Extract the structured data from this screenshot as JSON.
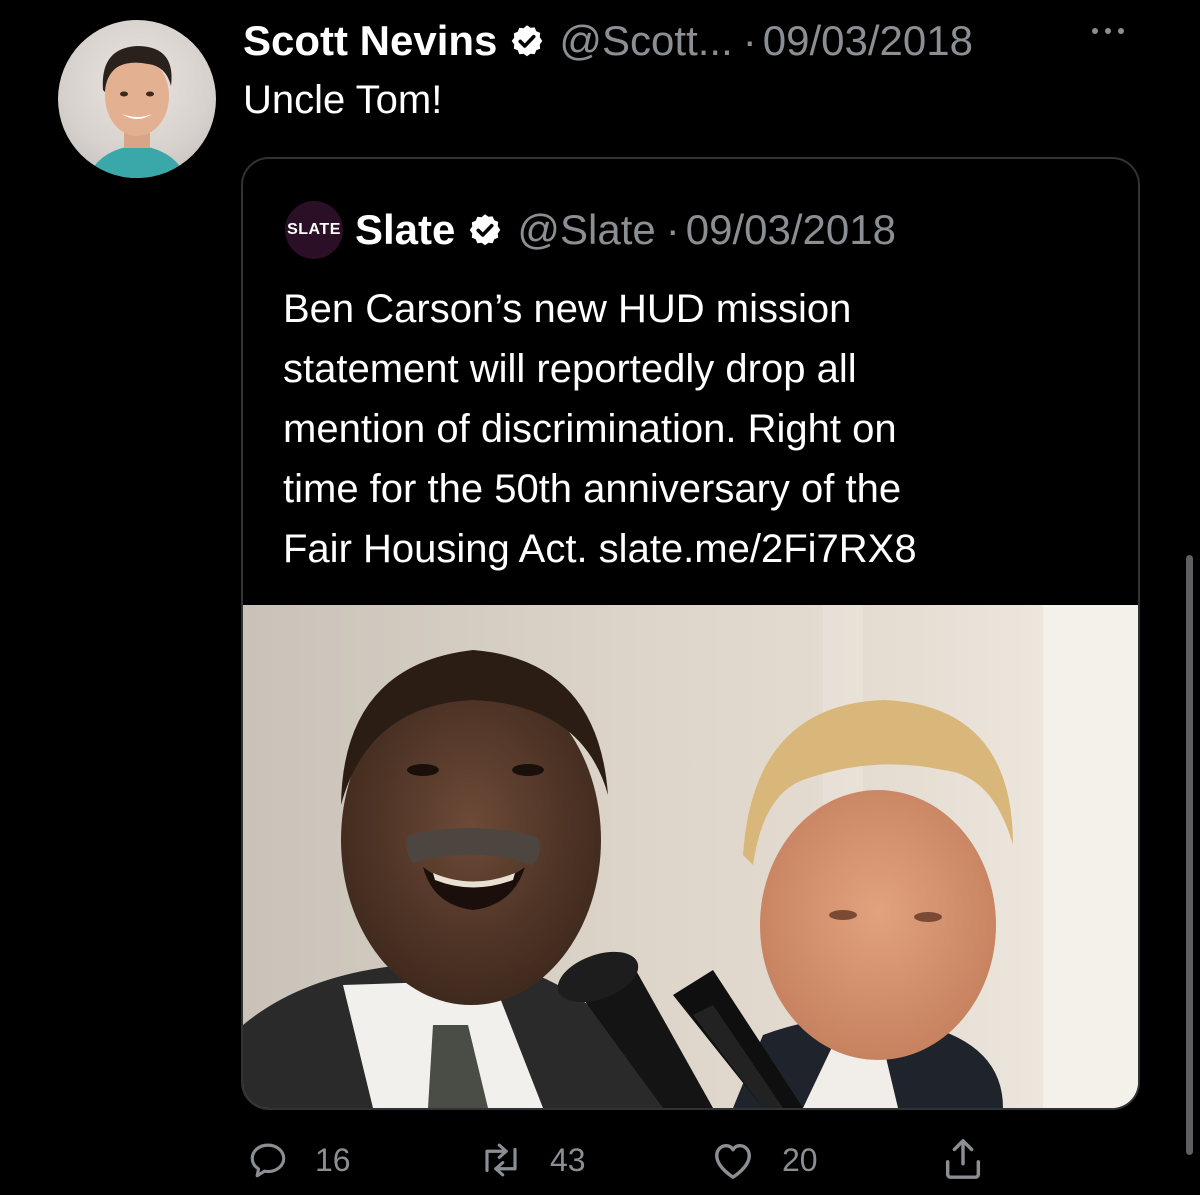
{
  "tweet": {
    "author_name": "Scott Nevins",
    "author_handle": "@Scott...",
    "separator": "·",
    "date": "09/03/2018",
    "text": "Uncle Tom!"
  },
  "quoted_tweet": {
    "logo_text": "SLATE",
    "author_name": "Slate",
    "author_handle": "@Slate",
    "separator": "·",
    "date": "09/03/2018",
    "text_lines": [
      "Ben Carson’s new HUD mission",
      "statement will reportedly drop all",
      "mention of discrimination. Right on",
      "time for the 50th anniversary of the",
      "Fair Housing Act. slate.me/2Fi7RX8"
    ]
  },
  "actions": {
    "replies": "16",
    "retweets": "43",
    "likes": "20"
  },
  "icons": {
    "verified": "verified-badge-icon",
    "more": "more-dots-icon",
    "reply": "reply-icon",
    "retweet": "retweet-icon",
    "like": "heart-icon",
    "share": "share-icon"
  },
  "colors": {
    "background": "#000000",
    "text": "#ffffff",
    "secondary_text": "#8b8e92",
    "border": "#2f3336",
    "slate_logo_bg": "#2b0f26"
  }
}
